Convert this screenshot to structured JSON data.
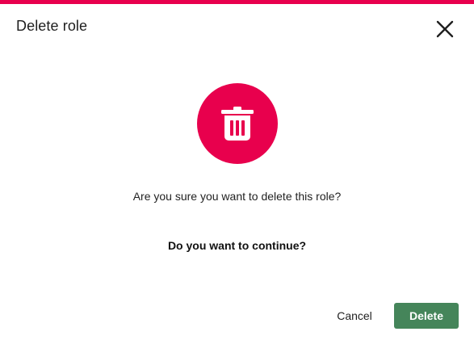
{
  "dialog": {
    "title": "Delete role",
    "close_icon": "close-icon",
    "hero_icon": "trash-icon",
    "message": "Are you sure you want to delete this role?",
    "question": "Do you want to continue?",
    "cancel_label": "Cancel",
    "delete_label": "Delete"
  },
  "colors": {
    "accent": "#e8004d",
    "confirm": "#45855a"
  }
}
